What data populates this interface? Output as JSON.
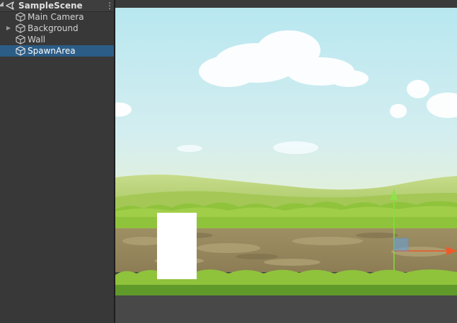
{
  "hierarchy": {
    "scene_name": "SampleScene",
    "menu_glyph": "⋮",
    "items": [
      {
        "label": "Main Camera",
        "expandable": false,
        "selected": false
      },
      {
        "label": "Background",
        "expandable": true,
        "selected": false
      },
      {
        "label": "Wall",
        "expandable": false,
        "selected": false
      },
      {
        "label": "SpawnArea",
        "expandable": false,
        "selected": true
      }
    ]
  },
  "icons": {
    "scene": "unity-logo-icon",
    "gameobject": "cube-icon",
    "expand": "triangle-right-icon",
    "menu": "kebab-menu-icon"
  },
  "colors": {
    "selection": "#2c5d87",
    "panel_bg": "#383838",
    "sky_top": "#b6e6ef",
    "grass": "#8fc33c",
    "gizmo_y": "#7fe03a",
    "gizmo_x": "#f0552a"
  }
}
